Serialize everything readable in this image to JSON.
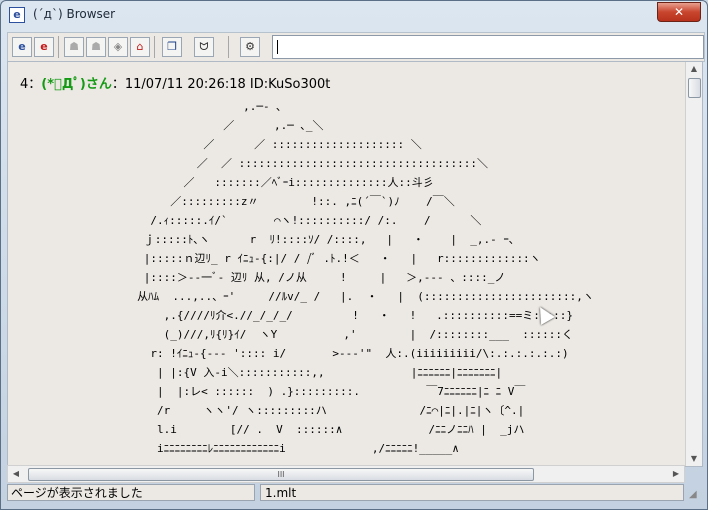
{
  "window": {
    "title": "(´д`) Browser",
    "close_label": "✕"
  },
  "toolbar": {
    "buttons": [
      {
        "name": "open-icon",
        "glyph": "e"
      },
      {
        "name": "open-red-icon",
        "glyph": "e"
      },
      {
        "name": "back-icon",
        "glyph": "☗"
      },
      {
        "name": "forward-icon",
        "glyph": "☗"
      },
      {
        "name": "up-icon",
        "glyph": "◈"
      },
      {
        "name": "home-icon",
        "glyph": "⌂"
      },
      {
        "name": "copy-icon",
        "glyph": "❐"
      },
      {
        "name": "face-icon",
        "glyph": "ᗢ"
      },
      {
        "name": "settings-icon",
        "glyph": "⚙"
      }
    ],
    "address_value": ""
  },
  "post": {
    "number": "4",
    "separator": "：",
    "name": "(*ﾟДﾟ)さん",
    "date": "：11/07/11 20:26:18 ID:KuSo300t"
  },
  "ascii_art": "                     ,.─‐ ､ \n                  ／      ,.─ ､_＼ \n               ／      ／ :::::::::::::::::::: ＼\n              ／  ／ ::::::::::::::::::::::::::::::::::::＼\n            ／   :::::::／ﾍﾞｰi::::::::::::::人::斗彡 \n          ／:::::::::z〃        !::. ,ﾆ(´￣`)ﾉ    /￣＼\n       /.ｨ:::::.ｲ/`       ⌒ヽ!::::::::::/ /:.    /      ＼\n      ｊ:::::ﾄ､ヽ      r  ﾘ!::::ｿ/ /::::,   |   ・    |  _,.‐ ｰ､\n      |:::::ｎ辺ﾘ_ r ｲﾆｭ‐{:|/ / /ﾞ .ﾄ.!＜   ・   |   r:::::::::::::ヽ\n      |::::＞‐‐一ﾞ- 辺ﾘ 从, /ノ从     !     |   ＞,-‐‐ 、::::_ノ\n     从ﾊﾑ  ...,..、ｰ'     //ﾙv/_ /   |.  ・   |  (:::::::::::::::::::::::,ヽ\n         ,.{////ﾘ介<.//_/_/_/         !   ・   !   .::::::::::==ミ:::::}\n         (_)///,ﾘ{ﾘ}ｲ/  ヽY          ,'        |  /::::::::___  ::::::く\n       r: !ｲﾆｭ‐{‐‐‐ ':::: i/       >‐‐‐'\"  人:.(iiiiiiiii/\\:.:.:.:.:.:)\n        | |:{V 入‐i＼:::::::::::,,             |ﾆﾆﾆﾆﾆﾆ|ﾆﾆﾆﾆﾆﾆﾆ|\n        |  |:レ< ::::::  ) .}:::::::::.          ￣7ﾆﾆﾆﾆﾆﾆ|ﾆ ﾆ V￣\n        /r     ヽヽ'/ ヽ:::::::::ハ              /ﾆ⌒|ﾆ|.|ﾆ|ヽ〔^.|\n        l.i        [// .  V  ::::::∧             /ﾆﾆノﾆﾆﾊ |  _jハ\n        iﾆﾆﾆﾆﾆﾆﾆﾆﾚﾆﾆﾆﾆﾆﾆﾆﾆﾆﾆﾆﾆi             ,/ﾆﾆﾆﾆﾆ!_____∧",
  "scrollbar": {
    "h_thumb_grip": "III",
    "up_arrow": "▲",
    "down_arrow": "▼",
    "left_arrow": "◀",
    "right_arrow": "▶"
  },
  "status": {
    "message": "ページが表示されました",
    "file": "1.mlt",
    "grip": "◢"
  }
}
